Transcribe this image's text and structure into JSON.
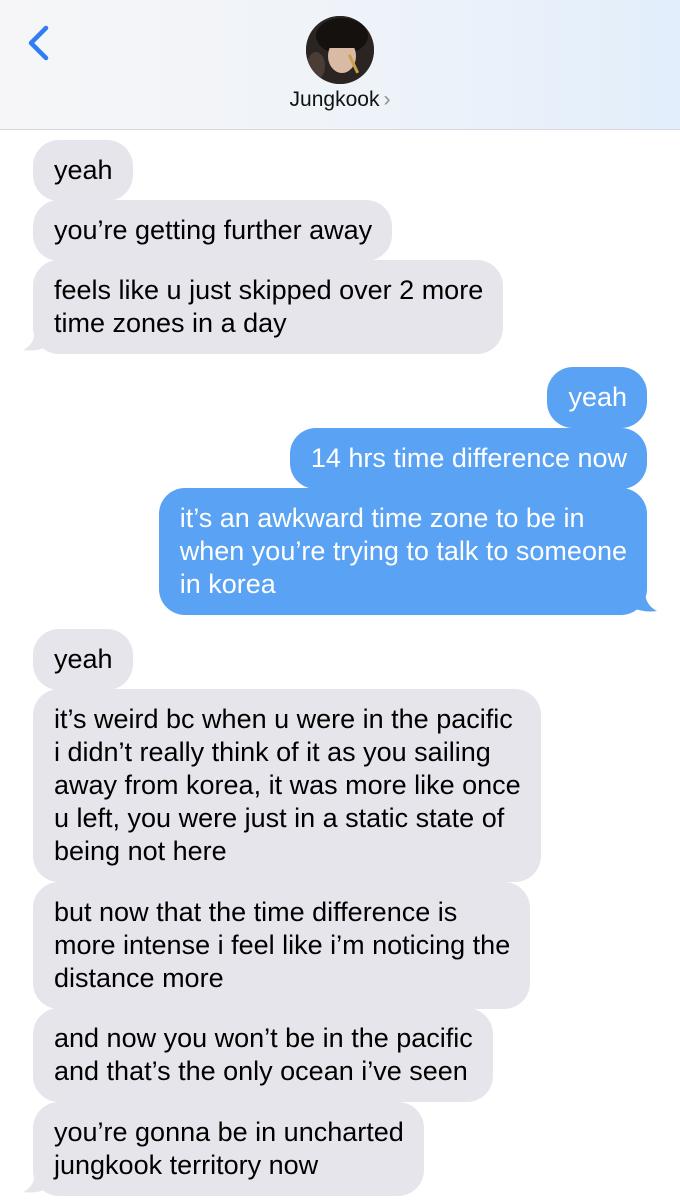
{
  "header": {
    "contact_name": "Jungkook",
    "chevron": "›",
    "back_icon": "chevron-left-icon",
    "accent_color": "#2f7df6"
  },
  "messages": [
    {
      "direction": "incoming",
      "text": [
        "yeah"
      ]
    },
    {
      "direction": "incoming",
      "text": [
        "you’re getting further away"
      ]
    },
    {
      "direction": "incoming",
      "text": [
        "feels like u just skipped over 2 more",
        "time zones in a day"
      ]
    },
    {
      "direction": "outgoing",
      "text": [
        "yeah"
      ]
    },
    {
      "direction": "outgoing",
      "text": [
        "14 hrs time difference now"
      ]
    },
    {
      "direction": "outgoing",
      "text": [
        "it’s an awkward time zone to be in",
        "when you’re trying to talk to someone",
        "in korea"
      ]
    },
    {
      "direction": "incoming",
      "text": [
        "yeah"
      ]
    },
    {
      "direction": "incoming",
      "text": [
        "it’s weird bc when u were in the pacific",
        "i didn’t really think of it as you sailing",
        "away from korea, it was more like once",
        "u left, you were just in a static state of",
        "being not here"
      ]
    },
    {
      "direction": "incoming",
      "text": [
        "but now that the time difference is",
        "more intense i feel like i’m noticing the",
        "distance more"
      ]
    },
    {
      "direction": "incoming",
      "text": [
        "and now you won’t be in the pacific",
        "and that’s the only ocean i’ve seen"
      ]
    },
    {
      "direction": "incoming",
      "text": [
        "you’re gonna be in uncharted",
        "jungkook territory now"
      ]
    }
  ],
  "colors": {
    "incoming_bubble": "#e6e5eb",
    "outgoing_bubble": "#5aa2f3",
    "outgoing_text": "#ffffff"
  }
}
